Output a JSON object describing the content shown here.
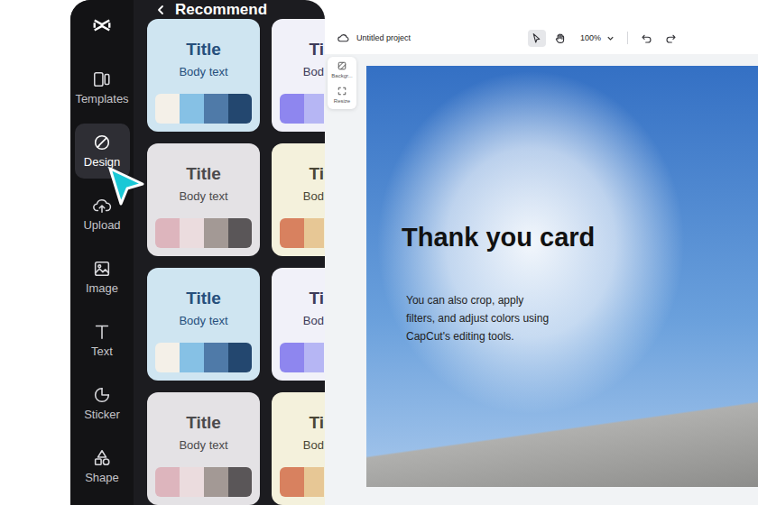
{
  "rail": {
    "items": [
      {
        "label": "Templates",
        "kind": "templates",
        "selected": false
      },
      {
        "label": "Design",
        "kind": "design",
        "selected": true
      },
      {
        "label": "Upload",
        "kind": "upload",
        "selected": false
      },
      {
        "label": "Image",
        "kind": "image",
        "selected": false
      },
      {
        "label": "Text",
        "kind": "text",
        "selected": false
      },
      {
        "label": "Sticker",
        "kind": "sticker",
        "selected": false
      },
      {
        "label": "Shape",
        "kind": "shape",
        "selected": false
      }
    ]
  },
  "panel": {
    "title": "Recommend",
    "cards": [
      {
        "title": "Title",
        "body": "Body text",
        "kind": "full",
        "color": "#cfe5f1",
        "ink": "#264f7c",
        "swatches": [
          "#f4f0e8",
          "#86c1e5",
          "#4f7aa8",
          "#23476f"
        ]
      },
      {
        "title": "Ti",
        "body": "Bod",
        "kind": "clipped",
        "color": "#f1f1f9",
        "ink": "#3d3b58",
        "swatches": [
          "#8e86ef",
          "#b6b6f4"
        ]
      },
      {
        "title": "Title",
        "body": "Body text",
        "kind": "full",
        "color": "#e4e2e5",
        "ink": "#4b4a4c",
        "swatches": [
          "#ddb5bd",
          "#ebdcde",
          "#a39995",
          "#5a5658"
        ]
      },
      {
        "title": "Ti",
        "body": "Bod",
        "kind": "clipped",
        "color": "#f4f1dc",
        "ink": "#4a4636",
        "swatches": [
          "#d8815f",
          "#e7c795"
        ]
      },
      {
        "title": "Title",
        "body": "Body text",
        "kind": "full",
        "color": "#cfe5f1",
        "ink": "#264f7c",
        "swatches": [
          "#f4f0e8",
          "#86c1e5",
          "#4f7aa8",
          "#23476f"
        ]
      },
      {
        "title": "Ti",
        "body": "Bod",
        "kind": "clipped",
        "color": "#f1f1f9",
        "ink": "#3d3b58",
        "swatches": [
          "#8e86ef",
          "#b6b6f4"
        ]
      },
      {
        "title": "Title",
        "body": "Body text",
        "kind": "full",
        "color": "#e4e2e5",
        "ink": "#4b4a4c",
        "swatches": [
          "#ddb5bd",
          "#ebdcde",
          "#a39995",
          "#5a5658"
        ]
      },
      {
        "title": "Ti",
        "body": "Bod",
        "kind": "clipped",
        "color": "#f4f1dc",
        "ink": "#4a4636",
        "swatches": [
          "#d8815f",
          "#e7c795"
        ]
      }
    ]
  },
  "topbar": {
    "project": "Untitled project",
    "zoom": "100%",
    "tools": [
      {
        "kind": "pointer",
        "selected": true
      },
      {
        "kind": "hand",
        "selected": false
      }
    ]
  },
  "float_toolbar": {
    "items": [
      {
        "label": "Backgr...",
        "kind": "background"
      },
      {
        "label": "Resize",
        "kind": "resize"
      }
    ]
  },
  "canvas": {
    "heading": "Thank you card",
    "body": "You can also crop, apply filters, and adjust colors using CapCut's editing tools."
  }
}
